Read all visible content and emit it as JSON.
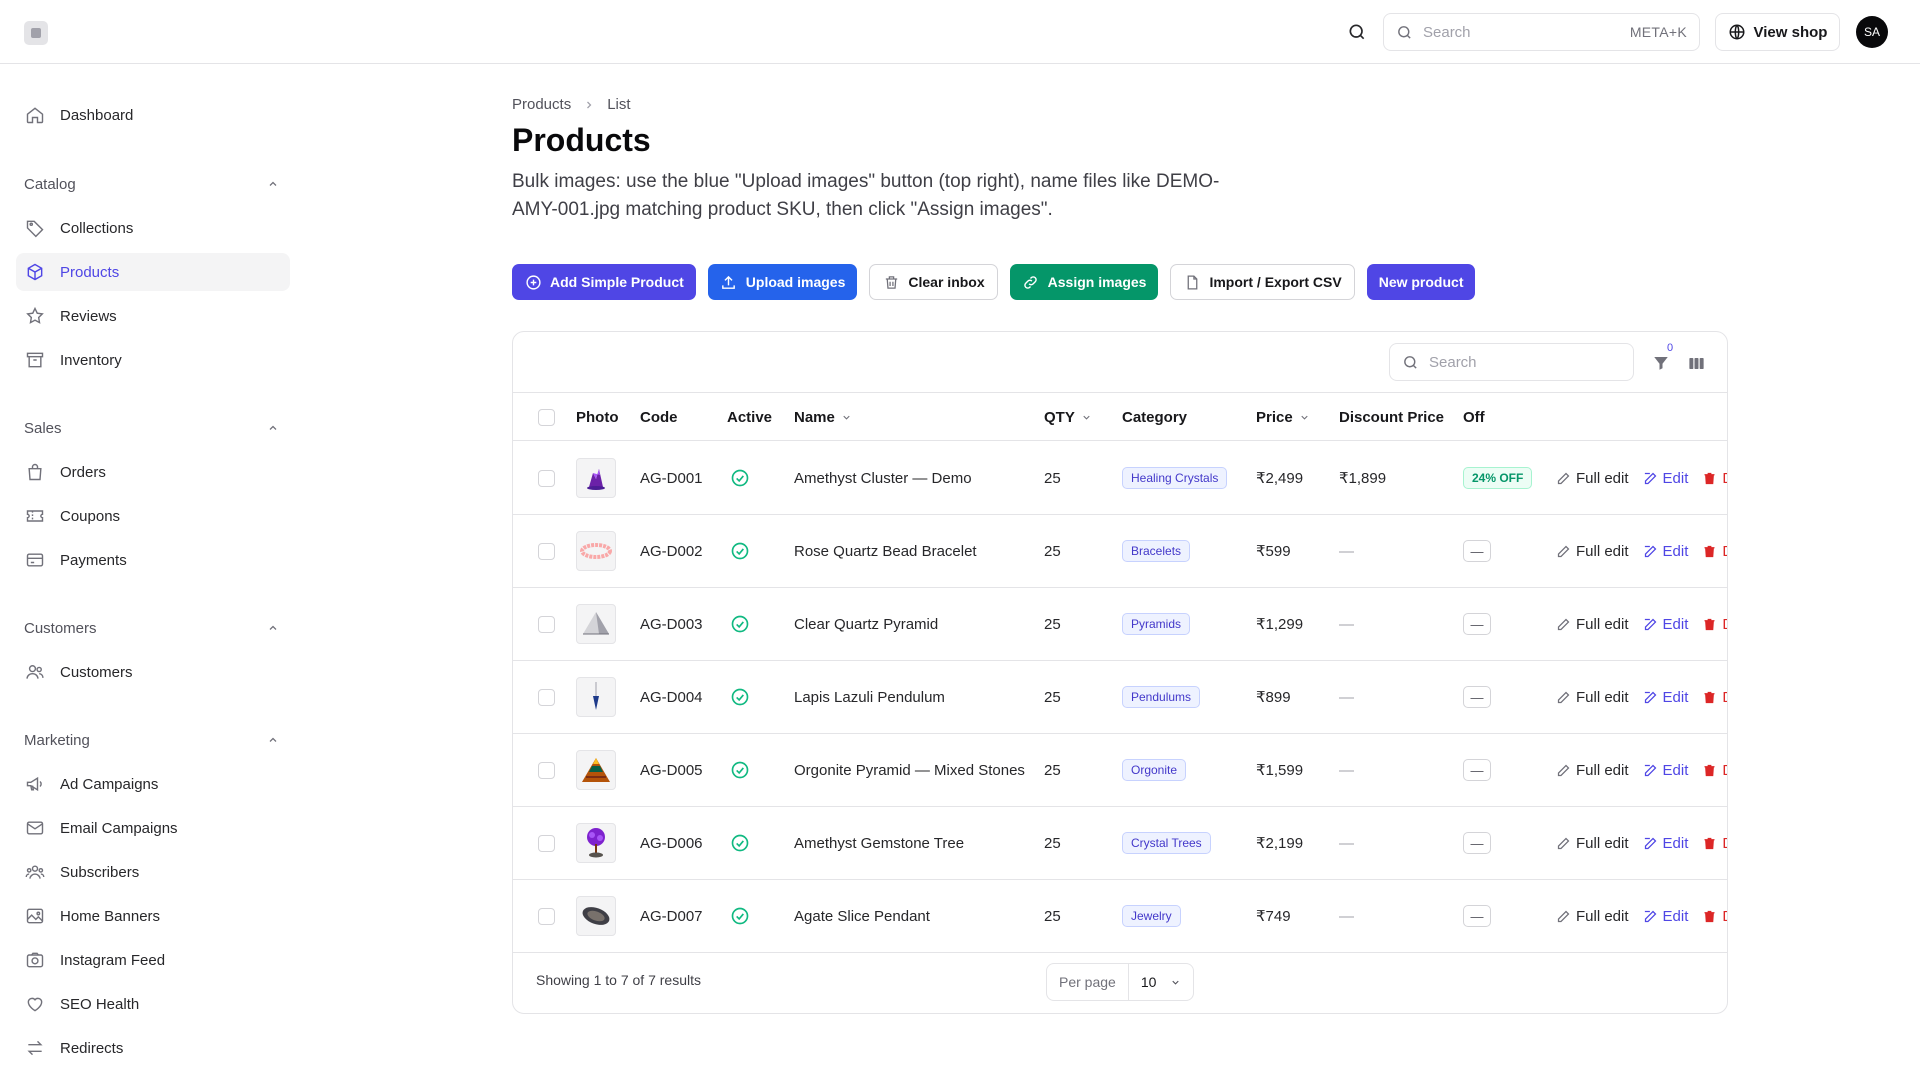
{
  "topbar": {
    "search_placeholder": "Search",
    "search_shortcut": "META+K",
    "view_shop_label": "View shop",
    "avatar_initials": "SA"
  },
  "sidebar": {
    "dashboard": "Dashboard",
    "groups": {
      "catalog": "Catalog",
      "sales": "Sales",
      "customers": "Customers",
      "marketing": "Marketing"
    },
    "items": {
      "collections": "Collections",
      "products": "Products",
      "reviews": "Reviews",
      "inventory": "Inventory",
      "orders": "Orders",
      "coupons": "Coupons",
      "payments": "Payments",
      "customers": "Customers",
      "ad_campaigns": "Ad Campaigns",
      "email_campaigns": "Email Campaigns",
      "subscribers": "Subscribers",
      "home_banners": "Home Banners",
      "instagram_feed": "Instagram Feed",
      "seo_health": "SEO Health",
      "redirects": "Redirects"
    }
  },
  "breadcrumb": {
    "parent": "Products",
    "current": "List"
  },
  "page": {
    "title": "Products",
    "description": "Bulk images: use the blue \"Upload images\" button (top right), name files like DEMO-AMY-001.jpg matching product SKU, then click \"Assign images\"."
  },
  "actions": {
    "add_simple": "Add Simple Product",
    "upload_images": "Upload images",
    "clear_inbox": "Clear inbox",
    "assign_images": "Assign images",
    "import_export": "Import / Export CSV",
    "new_product": "New product"
  },
  "table": {
    "search_placeholder": "Search",
    "filter_count": "0",
    "columns": {
      "photo": "Photo",
      "code": "Code",
      "active": "Active",
      "name": "Name",
      "qty": "QTY",
      "category": "Category",
      "price": "Price",
      "discount_price": "Discount Price",
      "off": "Off"
    },
    "row_actions": {
      "full_edit": "Full edit",
      "edit": "Edit",
      "delete": "D"
    },
    "empty_dash": "—",
    "rows": [
      {
        "code": "AG-D001",
        "name": "Amethyst Cluster — Demo",
        "qty": "25",
        "category": "Healing Crystals",
        "price": "₹2,499",
        "discount_price": "₹1,899",
        "off": "24% OFF",
        "thumb": "amethyst-cluster"
      },
      {
        "code": "AG-D002",
        "name": "Rose Quartz Bead Bracelet",
        "qty": "25",
        "category": "Bracelets",
        "price": "₹599",
        "discount_price": "—",
        "off": "—",
        "thumb": "rose-bracelet"
      },
      {
        "code": "AG-D003",
        "name": "Clear Quartz Pyramid",
        "qty": "25",
        "category": "Pyramids",
        "price": "₹1,299",
        "discount_price": "—",
        "off": "—",
        "thumb": "clear-pyramid"
      },
      {
        "code": "AG-D004",
        "name": "Lapis Lazuli Pendulum",
        "qty": "25",
        "category": "Pendulums",
        "price": "₹899",
        "discount_price": "—",
        "off": "—",
        "thumb": "lapis-pendulum"
      },
      {
        "code": "AG-D005",
        "name": "Orgonite Pyramid — Mixed Stones",
        "qty": "25",
        "category": "Orgonite",
        "price": "₹1,599",
        "discount_price": "—",
        "off": "—",
        "thumb": "orgonite-pyramid"
      },
      {
        "code": "AG-D006",
        "name": "Amethyst Gemstone Tree",
        "qty": "25",
        "category": "Crystal Trees",
        "price": "₹2,199",
        "discount_price": "—",
        "off": "—",
        "thumb": "gem-tree"
      },
      {
        "code": "AG-D007",
        "name": "Agate Slice Pendant",
        "qty": "25",
        "category": "Jewelry",
        "price": "₹749",
        "discount_price": "—",
        "off": "—",
        "thumb": "agate-slice"
      }
    ],
    "footer": {
      "showing": "Showing 1 to 7 of 7 results",
      "per_page_label": "Per page",
      "per_page_value": "10"
    }
  },
  "colors": {
    "primary": "#4f46e5",
    "upload_blue": "#2563eb",
    "assign_green": "#059669",
    "delete_red": "#dc2626",
    "active_green": "#10b981"
  }
}
